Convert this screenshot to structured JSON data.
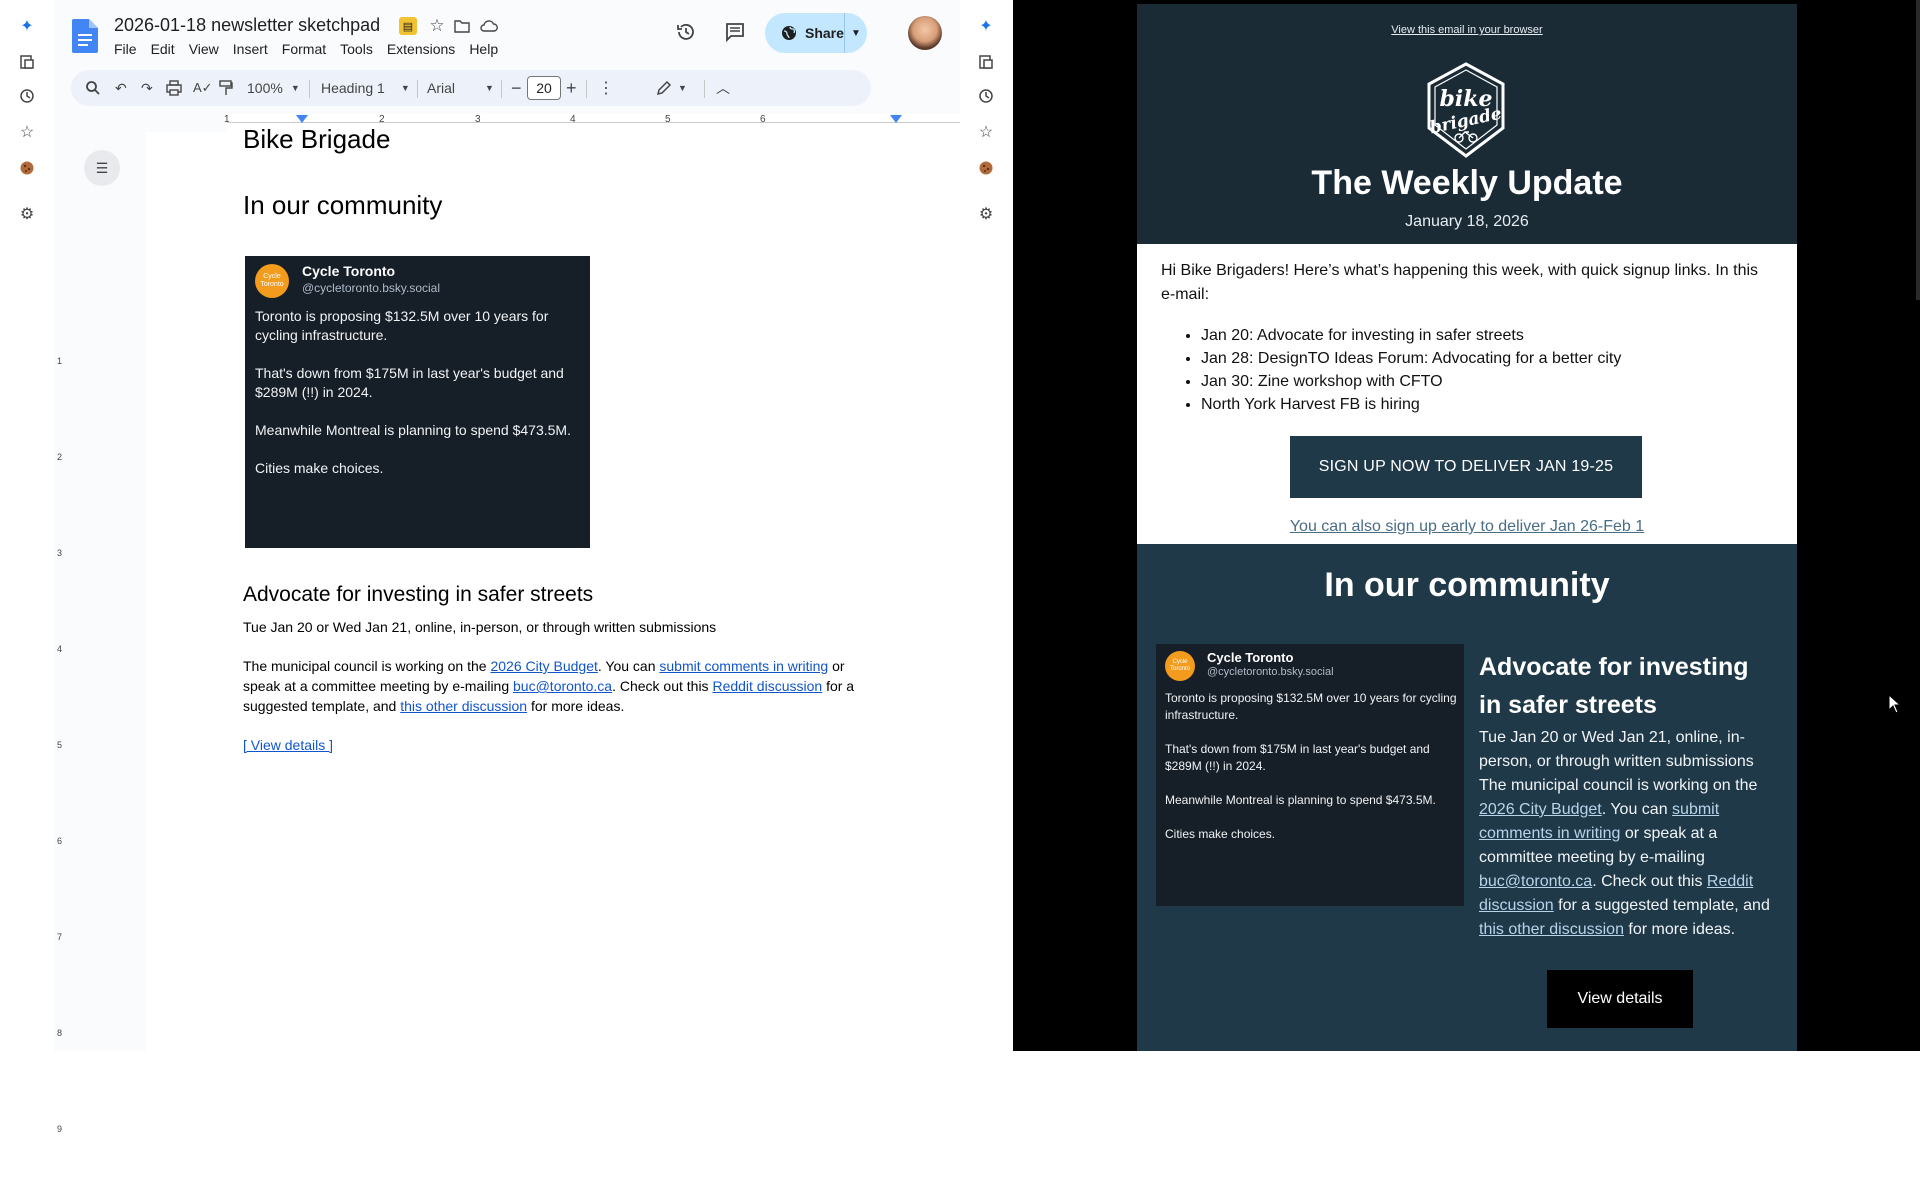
{
  "docs": {
    "title": "2026-01-18 newsletter sketchpad",
    "menus": [
      "File",
      "Edit",
      "View",
      "Insert",
      "Format",
      "Tools",
      "Extensions",
      "Help"
    ],
    "share_label": "Share",
    "toolbar": {
      "zoom": "100%",
      "style": "Heading 1",
      "font": "Arial",
      "font_size": "20"
    },
    "ruler_numbers": [
      "1",
      "2",
      "3",
      "4",
      "5",
      "6"
    ],
    "ruler_v_numbers": [
      "1",
      "2",
      "3",
      "4",
      "5",
      "6",
      "7",
      "8",
      "9"
    ],
    "body": {
      "title": "Bike Brigade",
      "community_heading": "In our community",
      "article_heading": "Advocate for investing in safer streets",
      "article_dates": "Tue Jan 20 or Wed Jan 21, online, in-person, or through written submissions",
      "p1": "The municipal council is working on the ",
      "link_budget": "2026 City Budget",
      "p2": ". You can ",
      "link_submit": "submit comments in writing",
      "p3": " or speak at a committee meeting by e-mailing ",
      "link_email": "buc@toronto.ca",
      "p4": ". Check out this ",
      "link_reddit": "Reddit discussion",
      "p5": " for a suggested template, and ",
      "link_other": "this other discussion",
      "p6": " for more ideas.",
      "view_details": "[ View details ]"
    }
  },
  "bsky": {
    "name": "Cycle Toronto",
    "handle": "@cycletoronto.bsky.social",
    "avatar_text": "Cycle Toronto",
    "post": "Toronto is proposing $132.5M over 10 years for cycling infrastructure.\n\nThat's down from $175M in last year's budget and $289M (!!) in 2024.\n\nMeanwhile Montreal is planning to spend $473.5M.\n\nCities make choices."
  },
  "email": {
    "view_in_browser": "View this email in your browser",
    "logo_alt": "Toronto bike brigade since 2020",
    "title": "The Weekly Update",
    "date": "January 18, 2026",
    "intro": "Hi Bike Brigaders! Here’s what’s happening this week, with quick signup links. In this e-mail:",
    "list": [
      "Jan 20: Advocate for investing in safer streets",
      "Jan 28: DesignTO Ideas Forum: Advocating for a better city",
      "Jan 30: Zine workshop with CFTO",
      "North York Harvest FB is hiring"
    ],
    "signup_button": "SIGN UP NOW TO DELIVER JAN 19-25",
    "signup_early": "You can also sign up early to deliver Jan 26-Feb 1",
    "community_heading": "In our community",
    "article_title": "Advocate for investing in safer streets",
    "article_dates": "Tue Jan 20 or Wed Jan 21, online, in-person, or through written submissions",
    "p1": "The municipal council is working on the ",
    "link_budget": "2026 City Budget",
    "p2": ". You can ",
    "link_submit": "submit comments in writing",
    "p3": " or speak at a committee meeting by e-mailing ",
    "link_email": "buc@toronto.ca",
    "p4": ". Check out this ",
    "link_reddit": "Reddit discussion",
    "p5": " for a suggested template, and ",
    "link_other": "this other discussion",
    "p6": " for more ideas.",
    "view_details": "View details"
  },
  "colors": {
    "email_header": "#1b2b36",
    "email_section": "#1f3948",
    "share_bg": "#c2e7ff",
    "doc_link": "#1155cc",
    "bsky_bg": "#161e27",
    "bsky_avatar": "#f29b1c"
  }
}
